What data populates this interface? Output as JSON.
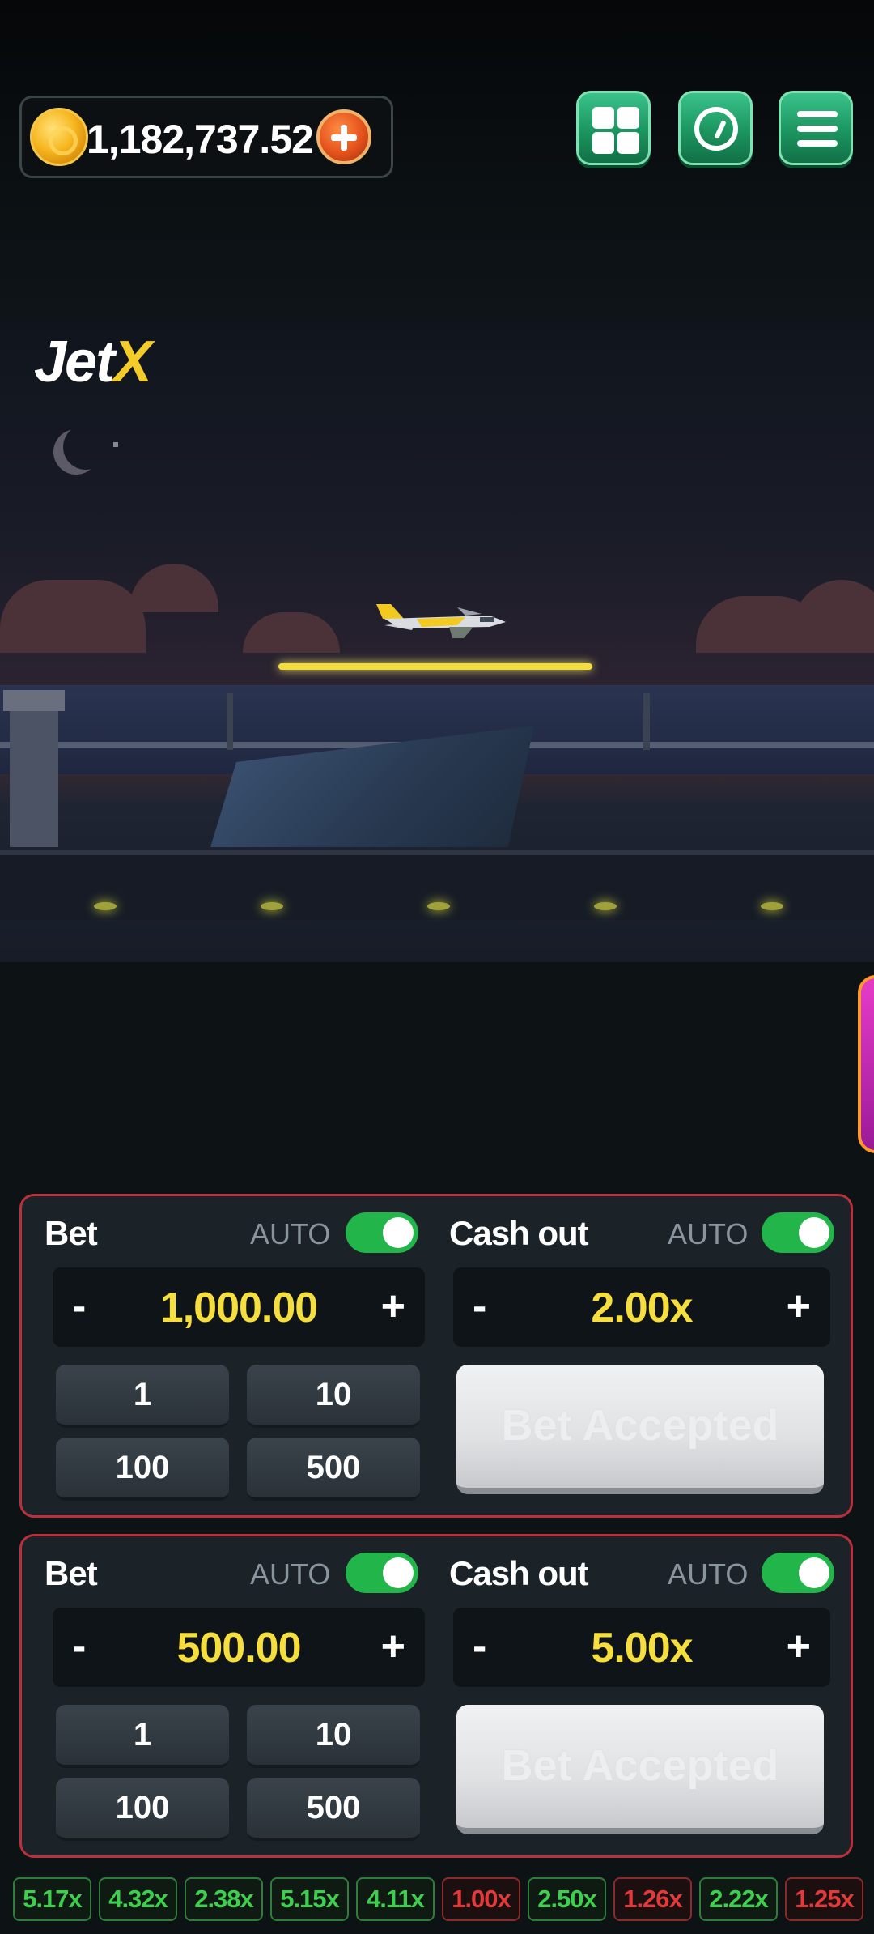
{
  "header": {
    "balance": "1,182,737.52"
  },
  "game": {
    "logo_main": "Jet",
    "logo_accent": "X"
  },
  "bet_panels": [
    {
      "bet_label": "Bet",
      "bet_auto_label": "AUTO",
      "bet_auto_on": true,
      "bet_value": "1,000.00",
      "minus": "-",
      "plus": "+",
      "chips": [
        "1",
        "10",
        "100",
        "500"
      ],
      "cashout_label": "Cash out",
      "cashout_auto_label": "AUTO",
      "cashout_auto_on": true,
      "cashout_value": "2.00x",
      "action_label": "Bet Accepted"
    },
    {
      "bet_label": "Bet",
      "bet_auto_label": "AUTO",
      "bet_auto_on": true,
      "bet_value": "500.00",
      "minus": "-",
      "plus": "+",
      "chips": [
        "1",
        "10",
        "100",
        "500"
      ],
      "cashout_label": "Cash out",
      "cashout_auto_label": "AUTO",
      "cashout_auto_on": true,
      "cashout_value": "5.00x",
      "action_label": "Bet Accepted"
    }
  ],
  "history": [
    {
      "value": "5.17x",
      "status": "win"
    },
    {
      "value": "4.32x",
      "status": "win"
    },
    {
      "value": "2.38x",
      "status": "win"
    },
    {
      "value": "5.15x",
      "status": "win"
    },
    {
      "value": "4.11x",
      "status": "win"
    },
    {
      "value": "1.00x",
      "status": "loss"
    },
    {
      "value": "2.50x",
      "status": "win"
    },
    {
      "value": "1.26x",
      "status": "loss"
    },
    {
      "value": "2.22x",
      "status": "win"
    },
    {
      "value": "1.25x",
      "status": "loss"
    }
  ],
  "colors": {
    "accent_yellow": "#f6de3d",
    "toggle_green": "#21b54a",
    "panel_border": "#b8313c",
    "win_text": "#3fcf4f",
    "loss_text": "#e03a3a",
    "win_border": "#2f7d3a",
    "loss_border": "#8a2a2a",
    "icon_button": "#1c9560"
  },
  "icons": [
    "coin-icon",
    "add-balance-icon",
    "grid-menu-icon",
    "clock-icon",
    "hamburger-icon",
    "jet-icon"
  ]
}
